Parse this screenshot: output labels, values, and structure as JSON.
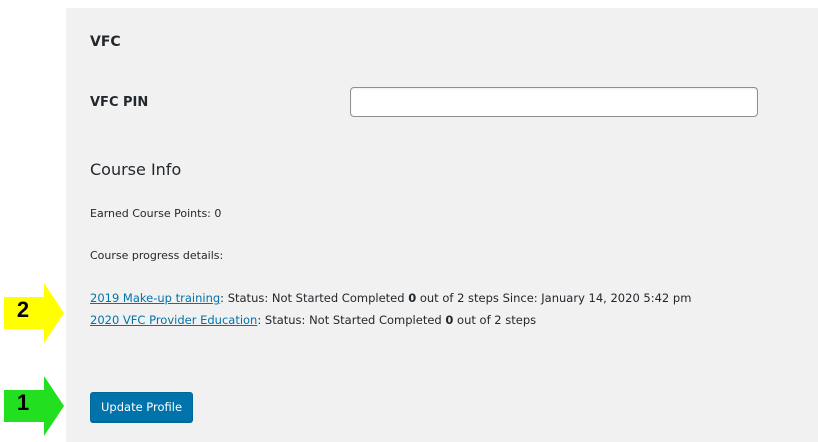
{
  "vfc": {
    "section_title": "VFC",
    "pin_label": "VFC PIN",
    "pin_value": ""
  },
  "course_info": {
    "title": "Course Info",
    "earned_label": "Earned Course Points: 0",
    "progress_label": "Course progress details:",
    "courses": [
      {
        "name": "2019 Make-up training",
        "status_prefix": ": Status: Not Started Completed ",
        "completed": "0",
        "status_suffix": " out of 2 steps Since: January 14, 2020 5:42 pm"
      },
      {
        "name": "2020 VFC Provider Education",
        "status_prefix": ": Status: Not Started Completed ",
        "completed": "0",
        "status_suffix": " out of 2 steps"
      }
    ]
  },
  "actions": {
    "update_label": "Update Profile"
  },
  "annotations": {
    "arrow_1_label": "1",
    "arrow_1_color": "#22e01f",
    "arrow_2_label": "2",
    "arrow_2_color": "#ffff00"
  }
}
